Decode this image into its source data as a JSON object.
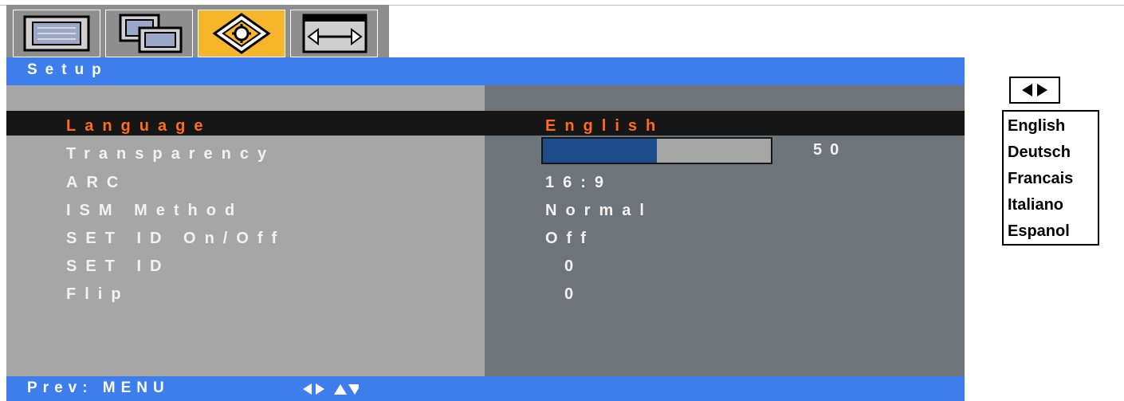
{
  "tabs": [
    {
      "icon": "monitor-picture-icon",
      "active": false
    },
    {
      "icon": "dual-screen-icon",
      "active": false
    },
    {
      "icon": "setup-gear-icon",
      "active": true
    },
    {
      "icon": "screen-resize-arrows-icon",
      "active": false
    }
  ],
  "header": {
    "title": "Setup"
  },
  "menu": [
    {
      "label": "Language",
      "value": "English",
      "selected": true
    },
    {
      "label": "Transparency",
      "value": "50",
      "type": "slider",
      "level": 50
    },
    {
      "label": "ARC",
      "value": "16:9"
    },
    {
      "label": "ISM Method",
      "value": "Normal"
    },
    {
      "label": "SET ID On/Off",
      "value": "Off"
    },
    {
      "label": "SET ID",
      "value": "0"
    },
    {
      "label": "Flip",
      "value": "0"
    }
  ],
  "footer": {
    "prev_label": "Prev: MENU",
    "nav_icon": "arrow-keys-icon"
  },
  "language_popup": {
    "arrows_icon": "left-right-arrows-icon",
    "options": [
      "English",
      "Deutsch",
      "Francais",
      "Italiano",
      "Espanol"
    ]
  },
  "colors": {
    "header_blue": "#3e7dec",
    "selected_text": "#ff6c1c",
    "active_tab": "#f7b52b",
    "slider_fill": "#1d4d8a"
  }
}
